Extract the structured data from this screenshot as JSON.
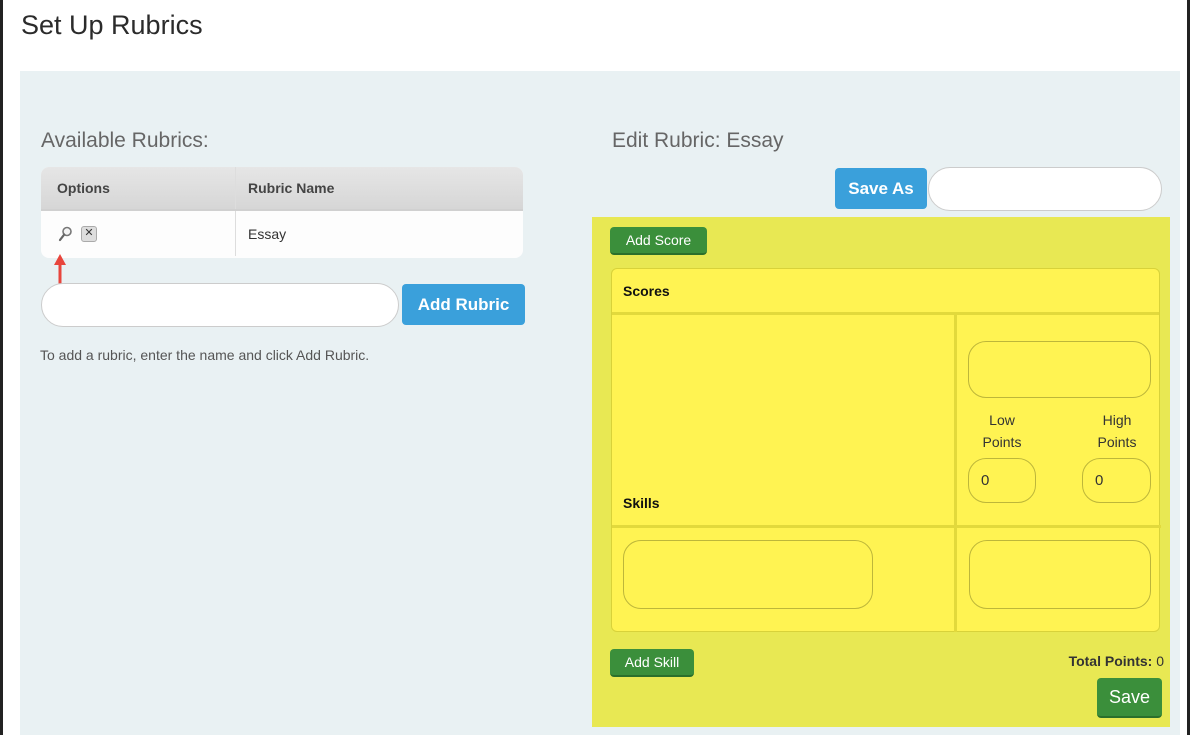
{
  "page": {
    "title": "Set Up Rubrics"
  },
  "available": {
    "title": "Available Rubrics:",
    "columns": [
      "Options",
      "Rubric Name"
    ],
    "rows": [
      {
        "name": "Essay"
      }
    ],
    "icons": {
      "view": "magnifier-icon",
      "delete": "close-x-icon"
    },
    "new_name_value": "",
    "add_button": "Add Rubric",
    "hint": "To add a rubric, enter the name and click Add Rubric."
  },
  "edit": {
    "title": "Edit Rubric: Essay",
    "save_as_button": "Save As",
    "save_as_value": "",
    "add_score_button": "Add Score",
    "scores_label": "Scores",
    "skills_label": "Skills",
    "score_name_value": "",
    "low_label": "Low Points",
    "high_label": "High Points",
    "low_value": "0",
    "high_value": "0",
    "skill_value": "",
    "skill_cell_value": "",
    "add_skill_button": "Add Skill",
    "total_label": "Total Points:",
    "total_value": "0",
    "save_button": "Save"
  },
  "colors": {
    "accent_blue": "#3aa0db",
    "accent_green": "#3b8f3b",
    "panel_yellow": "#e8e853",
    "cell_yellow": "#fff352",
    "content_bg": "#e9f1f3",
    "arrow_red": "#e8453c"
  }
}
